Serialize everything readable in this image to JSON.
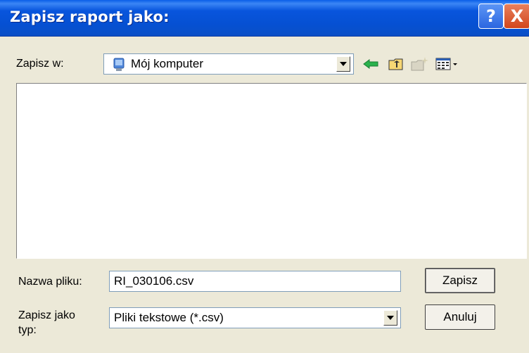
{
  "dialog": {
    "title": "Zapisz raport jako:",
    "help_glyph": "?",
    "close_glyph": "X"
  },
  "location": {
    "label": "Zapisz w:",
    "value": "Mój komputer",
    "icon": "computer-icon"
  },
  "toolbar": {
    "icons": [
      "back-arrow-icon",
      "up-folder-icon",
      "new-folder-icon",
      "view-menu-icon"
    ]
  },
  "file_list": {
    "items": []
  },
  "filename": {
    "label": "Nazwa pliku:",
    "value": "RI_030106.csv"
  },
  "filetype": {
    "label_line1": "Zapisz jako",
    "label_line2": "typ:",
    "value": "Pliki tekstowe (*.csv)"
  },
  "buttons": {
    "save": "Zapisz",
    "cancel": "Anuluj"
  },
  "colors": {
    "titlebar": "#0855dd",
    "window_bg": "#ece9d8",
    "close_btn": "#d2461c",
    "back_arrow": "#1fa54a"
  }
}
